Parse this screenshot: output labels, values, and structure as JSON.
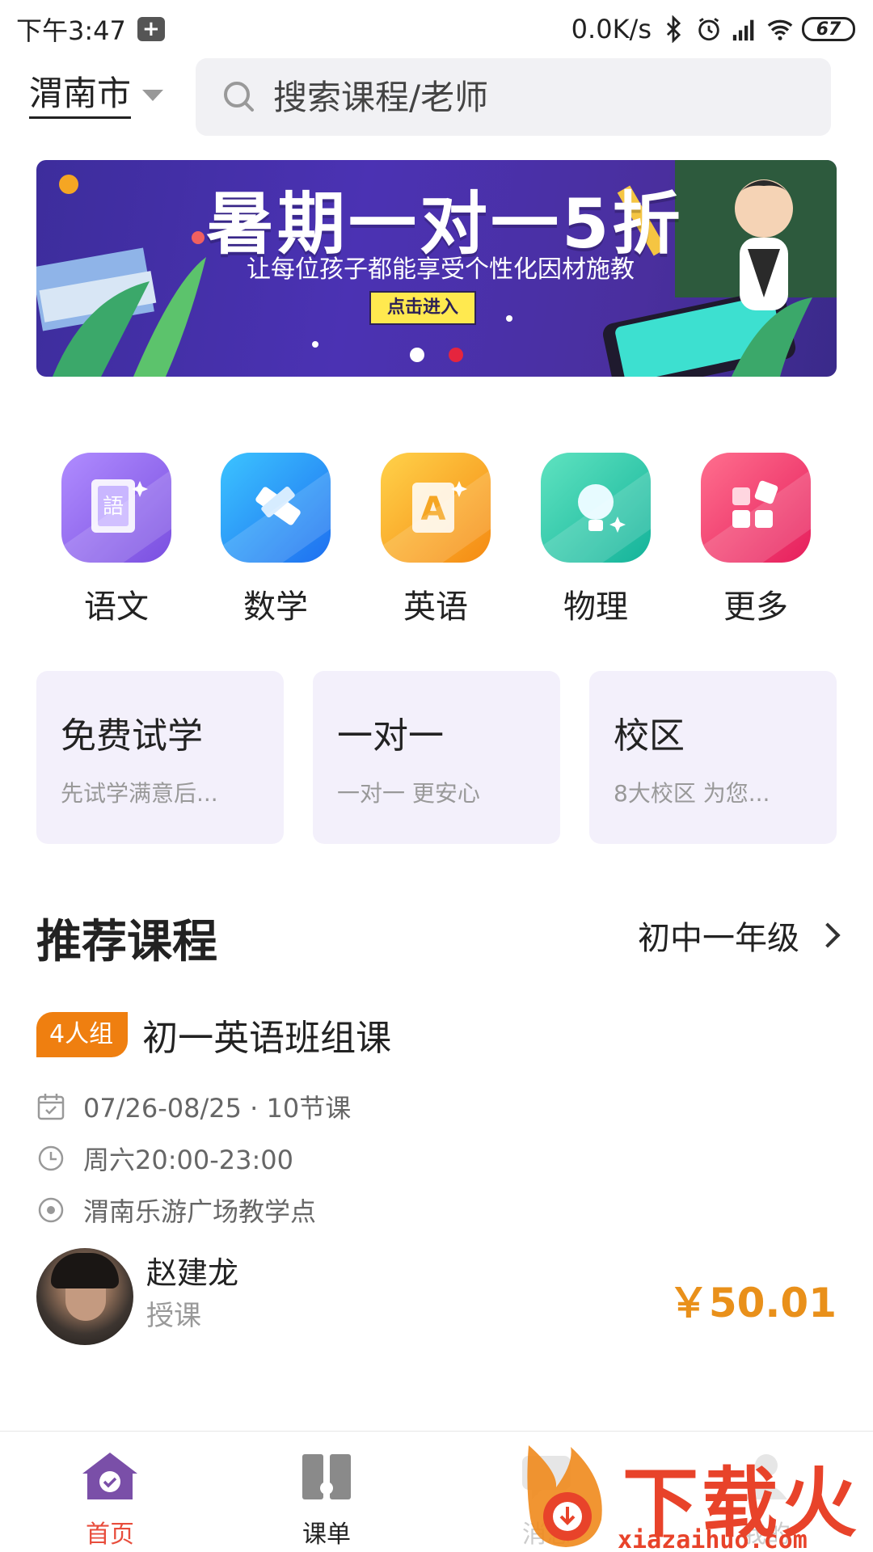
{
  "status_bar": {
    "time": "下午3:47",
    "network_speed": "0.0K/s",
    "battery": "67"
  },
  "header": {
    "city": "渭南市",
    "search_placeholder": "搜索课程/老师"
  },
  "banner": {
    "title": "暑期一对一5折",
    "subtitle": "让每位孩子都能享受个性化因材施教",
    "button": "点击进入",
    "page_count": 2,
    "active_page": 2
  },
  "categories": [
    {
      "label": "语文",
      "icon": "chinese-book-icon",
      "color": "#8a5cf0"
    },
    {
      "label": "数学",
      "icon": "ruler-pencil-icon",
      "color": "#1e90f5"
    },
    {
      "label": "英语",
      "icon": "letter-a-icon",
      "color": "#f7a21b"
    },
    {
      "label": "物理",
      "icon": "lightbulb-icon",
      "color": "#23c9a6"
    },
    {
      "label": "更多",
      "icon": "blocks-icon",
      "color": "#f0386b"
    }
  ],
  "feature_cards": [
    {
      "title": "免费试学",
      "subtitle": "先试学满意后..."
    },
    {
      "title": "一对一",
      "subtitle": "一对一 更安心"
    },
    {
      "title": "校区",
      "subtitle": "8大校区 为您..."
    }
  ],
  "recommend": {
    "title": "推荐课程",
    "grade": "初中一年级"
  },
  "course": {
    "tag": "4人组",
    "title": "初一英语班组课",
    "dates": "07/26-08/25 · 10节课",
    "schedule": "周六20:00-23:00",
    "location": "渭南乐游广场教学点",
    "teacher_name": "赵建龙",
    "teacher_role": "授课",
    "price": "￥50.01"
  },
  "tabbar": {
    "items": [
      {
        "label": "首页",
        "icon": "home-icon"
      },
      {
        "label": "课单",
        "icon": "schedule-book-icon"
      },
      {
        "label": "消息",
        "icon": "message-icon"
      },
      {
        "label": "我的",
        "icon": "profile-icon"
      }
    ]
  },
  "watermark": {
    "text": "下载火",
    "url": "xiazaihuo.com"
  },
  "colors": {
    "accent_purple": "#7a4fe0",
    "price_orange": "#e9901a",
    "tag_orange": "#ef7f10",
    "tab_active": "#e84d3c"
  }
}
